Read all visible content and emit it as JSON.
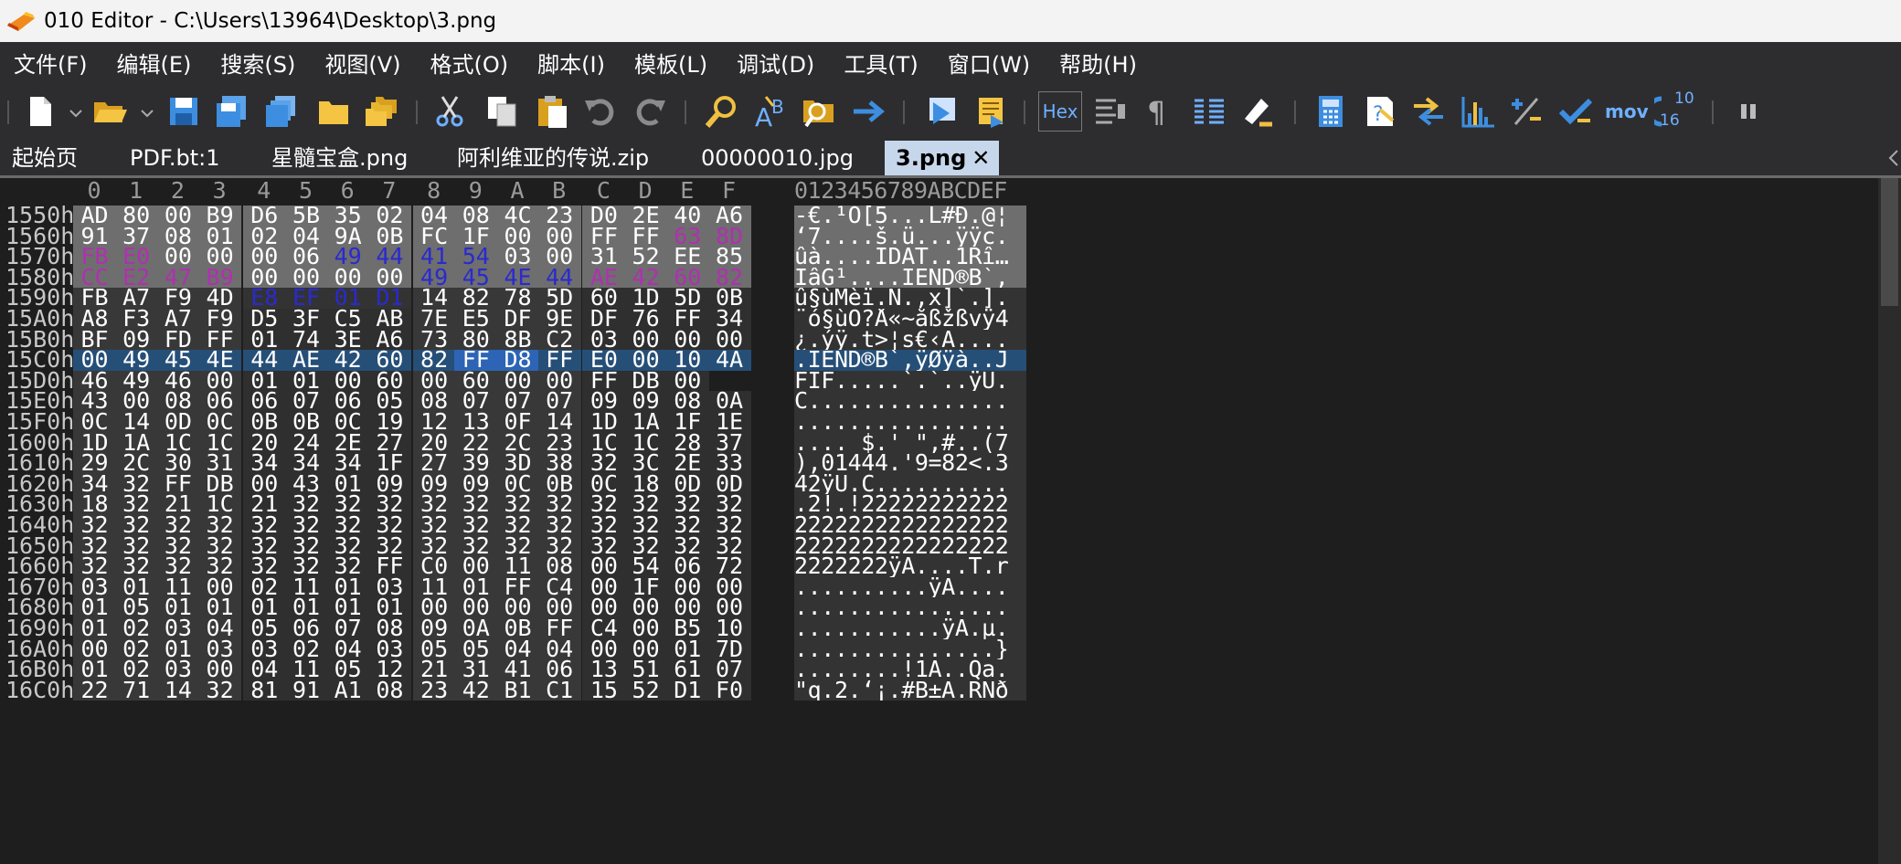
{
  "title_bar": {
    "text": "010 Editor - C:\\Users\\13964\\Desktop\\3.png",
    "icon": "010-editor-logo-icon"
  },
  "menu": [
    "文件(F)",
    "编辑(E)",
    "搜索(S)",
    "视图(V)",
    "格式(O)",
    "脚本(I)",
    "模板(L)",
    "调试(D)",
    "工具(T)",
    "窗口(W)",
    "帮助(H)"
  ],
  "toolbar": {
    "hex_label": "Hex",
    "mov_label": "mov",
    "base_label_top": "10",
    "base_label_bottom": "16",
    "icons": [
      "new-file-icon",
      "open-folder-icon",
      "save-icon",
      "save-as-icon",
      "save-all-icon",
      "open-workspace-icon",
      "open-multiple-icon",
      "cut-icon",
      "copy-icon",
      "paste-icon",
      "undo-icon",
      "redo-icon",
      "find-icon",
      "replace-icon",
      "find-in-files-icon",
      "goto-icon",
      "run-script-icon",
      "run-template-icon",
      "hex-mode-icon",
      "edit-as-icon",
      "show-paragraph-icon",
      "columns-icon",
      "highlight-icon",
      "calculator-icon",
      "base-converter-icon",
      "compare-icon",
      "histogram-icon",
      "checksum-icon",
      "verify-icon",
      "hex-operations-icon",
      "convert-base-icon",
      "pause-icon"
    ]
  },
  "tabs": [
    {
      "label": "起始页",
      "active": false
    },
    {
      "label": "PDF.bt:1",
      "active": false
    },
    {
      "label": "星髓宝盒.png",
      "active": false
    },
    {
      "label": "阿利维亚的传说.zip",
      "active": false
    },
    {
      "label": "00000010.jpg",
      "active": false
    },
    {
      "label": "3.png",
      "active": true
    }
  ],
  "tab_close_symbol": "✕",
  "hex": {
    "column_headers": [
      "0",
      "1",
      "2",
      "3",
      "4",
      "5",
      "6",
      "7",
      "8",
      "9",
      "A",
      "B",
      "C",
      "D",
      "E",
      "F"
    ],
    "ascii_header": "0123456789ABCDEF",
    "rows": [
      {
        "addr": "1550h:",
        "bytes": [
          "AD",
          "80",
          "00",
          "B9",
          "D6",
          "5B",
          "35",
          "02",
          "04",
          "08",
          "4C",
          "23",
          "D0",
          "2E",
          "40",
          "A6"
        ],
        "ascii": "-€.¹Ö[5...L#Ð.@¦"
      },
      {
        "addr": "1560h:",
        "bytes": [
          "91",
          "37",
          "08",
          "01",
          "02",
          "04",
          "9A",
          "0B",
          "FC",
          "1F",
          "00",
          "00",
          "FF",
          "FF",
          "63",
          "8D"
        ],
        "ascii": "‘7....š.ü...ÿÿc."
      },
      {
        "addr": "1570h:",
        "bytes": [
          "FB",
          "E0",
          "00",
          "00",
          "00",
          "06",
          "49",
          "44",
          "41",
          "54",
          "03",
          "00",
          "31",
          "52",
          "EE",
          "85"
        ],
        "ascii": "ûà....IDAT..1Rî…"
      },
      {
        "addr": "1580h:",
        "bytes": [
          "CC",
          "E2",
          "47",
          "B9",
          "00",
          "00",
          "00",
          "00",
          "49",
          "45",
          "4E",
          "44",
          "AE",
          "42",
          "60",
          "82"
        ],
        "ascii": "ÌâG¹....IEND®B`‚"
      },
      {
        "addr": "1590h:",
        "bytes": [
          "FB",
          "A7",
          "F9",
          "4D",
          "E8",
          "EF",
          "01",
          "D1",
          "14",
          "82",
          "78",
          "5D",
          "60",
          "1D",
          "5D",
          "0B"
        ],
        "ascii": "û§ùMèï.Ñ.‚x]`.]."
      },
      {
        "addr": "15A0h:",
        "bytes": [
          "A8",
          "F3",
          "A7",
          "F9",
          "D5",
          "3F",
          "C5",
          "AB",
          "7E",
          "E5",
          "DF",
          "9E",
          "DF",
          "76",
          "FF",
          "34"
        ],
        "ascii": "¨ó§ùÕ?Å«~åßžßvÿ4"
      },
      {
        "addr": "15B0h:",
        "bytes": [
          "BF",
          "09",
          "FD",
          "FF",
          "01",
          "74",
          "3E",
          "A6",
          "73",
          "80",
          "8B",
          "C2",
          "03",
          "00",
          "00",
          "00"
        ],
        "ascii": "¿.ýÿ.t>¦s€‹Â...."
      },
      {
        "addr": "15C0h:",
        "bytes": [
          "00",
          "49",
          "45",
          "4E",
          "44",
          "AE",
          "42",
          "60",
          "82",
          "FF",
          "D8",
          "FF",
          "E0",
          "00",
          "10",
          "4A"
        ],
        "ascii": ".IEND®B`‚ÿØÿà..J"
      },
      {
        "addr": "15D0h:",
        "bytes": [
          "46",
          "49",
          "46",
          "00",
          "01",
          "01",
          "00",
          "60",
          "00",
          "60",
          "00",
          "00",
          "FF",
          "DB",
          "00"
        ],
        "ascii": "FIF.....`.`..ÿÛ."
      },
      {
        "addr": "15E0h:",
        "bytes": [
          "43",
          "00",
          "08",
          "06",
          "06",
          "07",
          "06",
          "05",
          "08",
          "07",
          "07",
          "07",
          "09",
          "09",
          "08",
          "0A"
        ],
        "ascii": "C..............."
      },
      {
        "addr": "15F0h:",
        "bytes": [
          "0C",
          "14",
          "0D",
          "0C",
          "0B",
          "0B",
          "0C",
          "19",
          "12",
          "13",
          "0F",
          "14",
          "1D",
          "1A",
          "1F",
          "1E"
        ],
        "ascii": "................"
      },
      {
        "addr": "1600h:",
        "bytes": [
          "1D",
          "1A",
          "1C",
          "1C",
          "20",
          "24",
          "2E",
          "27",
          "20",
          "22",
          "2C",
          "23",
          "1C",
          "1C",
          "28",
          "37"
        ],
        "ascii": ".... $.' \",#..(7"
      },
      {
        "addr": "1610h:",
        "bytes": [
          "29",
          "2C",
          "30",
          "31",
          "34",
          "34",
          "34",
          "1F",
          "27",
          "39",
          "3D",
          "38",
          "32",
          "3C",
          "2E",
          "33"
        ],
        "ascii": "),01444.'9=82<.3"
      },
      {
        "addr": "1620h:",
        "bytes": [
          "34",
          "32",
          "FF",
          "DB",
          "00",
          "43",
          "01",
          "09",
          "09",
          "09",
          "0C",
          "0B",
          "0C",
          "18",
          "0D",
          "0D"
        ],
        "ascii": "42ÿÛ.C.........."
      },
      {
        "addr": "1630h:",
        "bytes": [
          "18",
          "32",
          "21",
          "1C",
          "21",
          "32",
          "32",
          "32",
          "32",
          "32",
          "32",
          "32",
          "32",
          "32",
          "32",
          "32"
        ],
        "ascii": ".2!.!22222222222"
      },
      {
        "addr": "1640h:",
        "bytes": [
          "32",
          "32",
          "32",
          "32",
          "32",
          "32",
          "32",
          "32",
          "32",
          "32",
          "32",
          "32",
          "32",
          "32",
          "32",
          "32"
        ],
        "ascii": "2222222222222222"
      },
      {
        "addr": "1650h:",
        "bytes": [
          "32",
          "32",
          "32",
          "32",
          "32",
          "32",
          "32",
          "32",
          "32",
          "32",
          "32",
          "32",
          "32",
          "32",
          "32",
          "32"
        ],
        "ascii": "2222222222222222"
      },
      {
        "addr": "1660h:",
        "bytes": [
          "32",
          "32",
          "32",
          "32",
          "32",
          "32",
          "32",
          "FF",
          "C0",
          "00",
          "11",
          "08",
          "00",
          "54",
          "06",
          "72"
        ],
        "ascii": "2222222ÿÀ....T.r"
      },
      {
        "addr": "1670h:",
        "bytes": [
          "03",
          "01",
          "11",
          "00",
          "02",
          "11",
          "01",
          "03",
          "11",
          "01",
          "FF",
          "C4",
          "00",
          "1F",
          "00",
          "00"
        ],
        "ascii": "..........ÿÄ...."
      },
      {
        "addr": "1680h:",
        "bytes": [
          "01",
          "05",
          "01",
          "01",
          "01",
          "01",
          "01",
          "01",
          "00",
          "00",
          "00",
          "00",
          "00",
          "00",
          "00",
          "00"
        ],
        "ascii": "................"
      },
      {
        "addr": "1690h:",
        "bytes": [
          "01",
          "02",
          "03",
          "04",
          "05",
          "06",
          "07",
          "08",
          "09",
          "0A",
          "0B",
          "FF",
          "C4",
          "00",
          "B5",
          "10"
        ],
        "ascii": "...........ÿÄ.µ."
      },
      {
        "addr": "16A0h:",
        "bytes": [
          "00",
          "02",
          "01",
          "03",
          "03",
          "02",
          "04",
          "03",
          "05",
          "05",
          "04",
          "04",
          "00",
          "00",
          "01",
          "7D"
        ],
        "ascii": "...............}"
      },
      {
        "addr": "16B0h:",
        "bytes": [
          "01",
          "02",
          "03",
          "00",
          "04",
          "11",
          "05",
          "12",
          "21",
          "31",
          "41",
          "06",
          "13",
          "51",
          "61",
          "07"
        ],
        "ascii": "........!1A..Qa."
      },
      {
        "addr": "16C0h:",
        "bytes": [
          "22",
          "71",
          "14",
          "32",
          "81",
          "91",
          "A1",
          "08",
          "23",
          "42",
          "B1",
          "C1",
          "15",
          "52",
          "D1",
          "F0"
        ],
        "ascii": "\"q.2.‘¡.#B±Á.RÑð"
      }
    ]
  },
  "colors": {
    "window_bg": "#1e1e1e",
    "chrome_bg": "#2d2d30",
    "grey_highlight": "#6e6e6e",
    "selection_blue": "#264f78",
    "selection_bright": "#2d64b5",
    "text_purple": "#b030b0",
    "text_blue": "#2a2ad0",
    "accent_icon_blue": "#3d8ee0",
    "accent_icon_yellow": "#f0c040",
    "active_tab_bg": "#c7d7eb"
  }
}
